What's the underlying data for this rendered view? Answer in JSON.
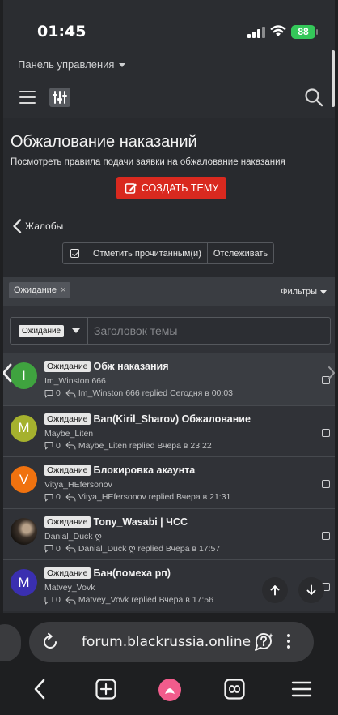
{
  "status_bar": {
    "time": "01:45",
    "battery": "88"
  },
  "header": {
    "panel_label": "Панель управления",
    "title": "Обжалование наказаний",
    "subtitle": "Посмотреть правила подачи заявки на обжалование наказания",
    "create_button": "СОЗДАТЬ ТЕМУ",
    "back_label": "Жалобы"
  },
  "actions": {
    "mark_read": "Отметить прочитанным(и)",
    "watch": "Отслеживать"
  },
  "filter_bar": {
    "chip": "Ожидание",
    "chip_close": "×",
    "filters_label": "Фильтры"
  },
  "search": {
    "prefix": "Ожидание",
    "placeholder": "Заголовок темы"
  },
  "threads": [
    {
      "initial": "I",
      "avatar_color": "#3fa33f",
      "label": "Ожидание",
      "title": "Обж наказания",
      "author": "Im_Winston 666",
      "replies": "0",
      "last": "Im_Winston 666 replied Сегодня в 00:03"
    },
    {
      "initial": "M",
      "avatar_color": "#a5b12e",
      "label": "Ожидание",
      "title": "Ban(Kiril_Sharov) Обжалование",
      "author": "Maybe_Liten",
      "replies": "0",
      "last": "Maybe_Liten replied Вчера в 23:22"
    },
    {
      "initial": "V",
      "avatar_color": "#f0720f",
      "label": "Ожидание",
      "title": "Блокировка акаунта",
      "author": "Vitya_HEfersonov",
      "replies": "0",
      "last": "Vitya_HEfersonov replied Вчера в 21:31"
    },
    {
      "initial": "",
      "avatar_color": "#2a2420",
      "label": "Ожидание",
      "title": "Tony_Wasabi | ЧСС",
      "author": "Danial_Duck ღ",
      "replies": "0",
      "last": "Danial_Duck ღ replied Вчера в 17:57"
    },
    {
      "initial": "M",
      "avatar_color": "#3a2fb0",
      "label": "Ожидание",
      "title": "Бан(помеха рп)",
      "author": "Matvey_Vovk",
      "replies": "0",
      "last": "Matvey_Vovk replied Вчера в 17:56"
    }
  ],
  "browser": {
    "url": "forum.blackrussia.online"
  },
  "colors": {
    "accent_red": "#d9291f",
    "background": "#2b2d31",
    "battery_green": "#34c759",
    "browser_logo": "#f25c8c"
  },
  "icons": [
    "signal-icon",
    "wifi-icon",
    "battery-icon",
    "menu-icon",
    "filter-settings-icon",
    "search-icon",
    "edit-icon",
    "chevron-left-icon",
    "checkbox-icon",
    "close-icon",
    "chevron-down-icon",
    "chat-bubble-icon",
    "reply-icon",
    "arrow-up-icon",
    "arrow-down-icon",
    "reload-icon",
    "ai-assistant-icon",
    "more-vertical-icon",
    "back-icon",
    "new-tab-icon",
    "browser-logo-icon",
    "tabs-icon",
    "hamburger-icon"
  ]
}
